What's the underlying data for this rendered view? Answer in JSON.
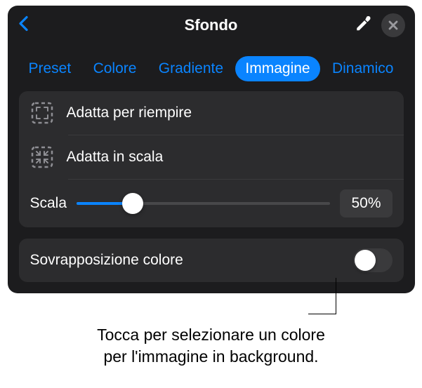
{
  "header": {
    "title": "Sfondo"
  },
  "tabs": [
    {
      "label": "Preset",
      "active": false
    },
    {
      "label": "Colore",
      "active": false
    },
    {
      "label": "Gradiente",
      "active": false
    },
    {
      "label": "Immagine",
      "active": true
    },
    {
      "label": "Dinamico",
      "active": false
    }
  ],
  "fitOptions": {
    "fill": "Adatta per riempire",
    "scale": "Adatta in scala"
  },
  "scaleControl": {
    "label": "Scala",
    "value": "50%"
  },
  "overlay": {
    "label": "Sovrapposizione colore"
  },
  "callout": {
    "line1": "Tocca per selezionare un colore",
    "line2": "per l'immagine in background."
  }
}
